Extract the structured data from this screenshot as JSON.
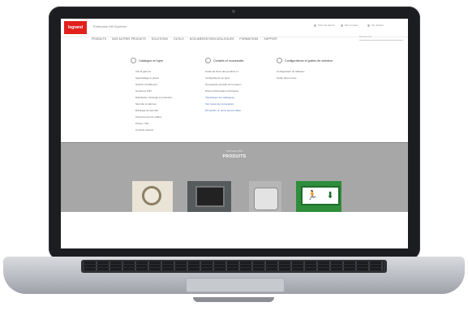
{
  "brand": {
    "logo_text": "legrand",
    "color": "#e2211c",
    "site_title": "Enterprise Mit Systems"
  },
  "utility": [
    {
      "label": "Pour les clients",
      "icon": "user-icon"
    },
    {
      "label": "Mon compte",
      "icon": "account-icon"
    },
    {
      "label": "Où acheter",
      "icon": "location-icon"
    }
  ],
  "search": {
    "placeholder": "Rechercher"
  },
  "nav": [
    {
      "label": "PRODUITS"
    },
    {
      "label": "NOS AUTRES PRODUITS"
    },
    {
      "label": "SOLUTIONS"
    },
    {
      "label": "OUTILS"
    },
    {
      "label": "DOCUMENTATION/CATALOGUES"
    },
    {
      "label": "FORMATIONS"
    },
    {
      "label": "SUPPORT"
    }
  ],
  "mega_menu": {
    "columns": [
      {
        "heading": "Catalogue en ligne",
        "icon": "catalog-icon",
        "items": [
          {
            "label": "Voir la gamme",
            "sub": true
          },
          {
            "label": "Appareillage et prises",
            "sub": true
          },
          {
            "label": "Gestion du bâtiment",
            "sub": true
          },
          {
            "label": "Systèmes KNX",
            "sub": true
          },
          {
            "label": "Distribution d'énergie et protection",
            "sub": true
          },
          {
            "label": "Sécurité et alarmes",
            "sub": true
          },
          {
            "label": "Éclairage de sécurité",
            "sub": true
          },
          {
            "label": "Cheminement de câbles",
            "sub": true
          },
          {
            "label": "Portes / VDI",
            "sub": true
          },
          {
            "label": "Contrôle d'accès",
            "sub": true
          }
        ]
      },
      {
        "heading": "Conseils et nouveautés",
        "icon": "info-icon",
        "items": [
          {
            "label": "Guide de choix des produits et",
            "sub": false
          },
          {
            "label": "configurateurs en ligne",
            "sub": false
          },
          {
            "label": "",
            "sub": false
          },
          {
            "label": "Nouveautés produits de la saison",
            "sub": false
          },
          {
            "label": "fiches d'information techniques",
            "sub": false
          },
          {
            "label": "",
            "sub": false
          },
          {
            "label": "Télécharger les catalogues",
            "sub": false,
            "link": true
          },
          {
            "label": "",
            "sub": false
          },
          {
            "label": "Voir toutes les nouveautés",
            "sub": false,
            "link": true
          },
          {
            "label": "Demander un devis personnalisé",
            "sub": false,
            "link": true
          }
        ]
      },
      {
        "heading": "Configurateurs et guides de sélection",
        "icon": "config-icon",
        "items": [
          {
            "label": "Configurateur de tableaux",
            "sub": false
          },
          {
            "label": "Guide des normes",
            "sub": false
          }
        ]
      }
    ]
  },
  "featured": {
    "kicker": "NOUVEAUTÉS",
    "title": "PRODUITS",
    "background": "#a7a7a7",
    "products": [
      {
        "name": "thermostat-dial",
        "icon": "dial-icon"
      },
      {
        "name": "touch-screen-panel",
        "icon": "screen-icon"
      },
      {
        "name": "socket-module",
        "icon": "module-icon"
      },
      {
        "name": "emergency-exit-sign",
        "icon": "exit-sign-icon",
        "glyphs": [
          "🏃",
          "⬇"
        ]
      }
    ]
  }
}
